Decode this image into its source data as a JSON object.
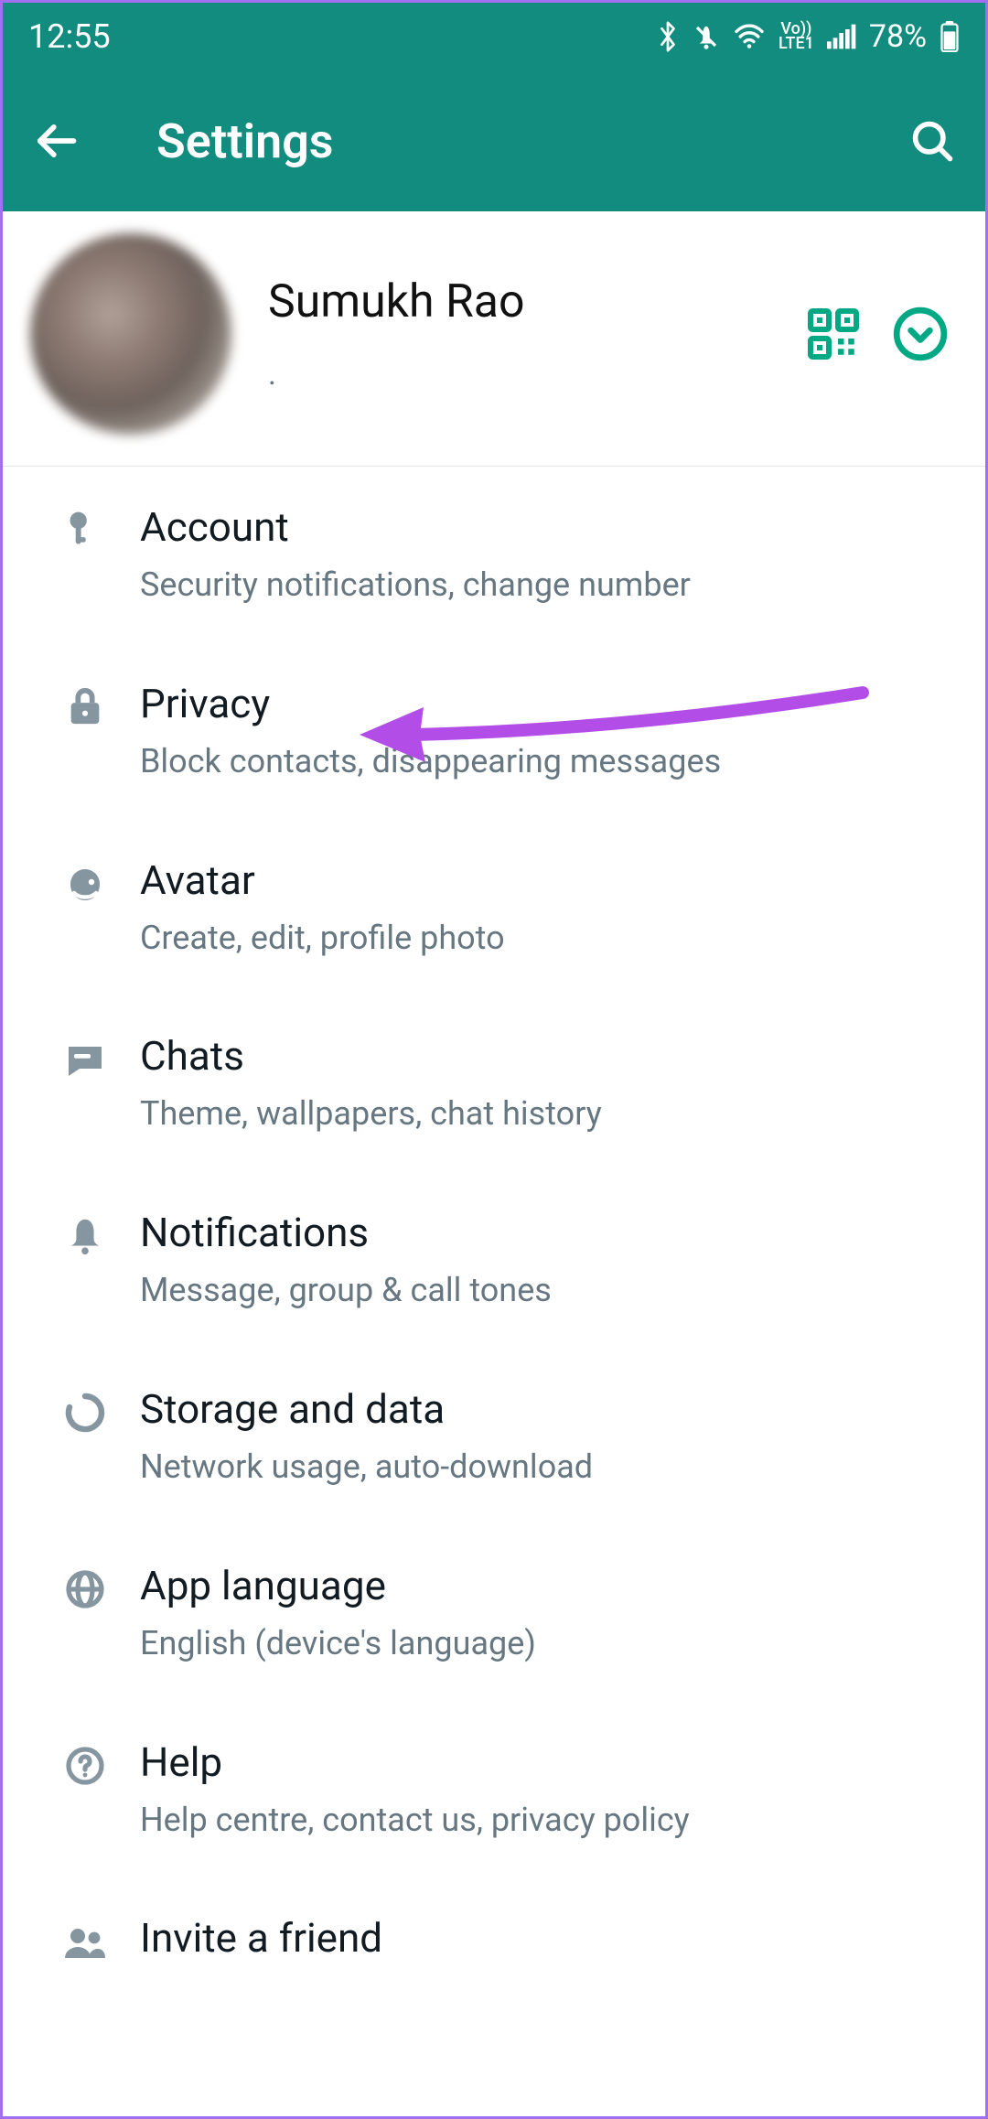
{
  "statusbar": {
    "time": "12:55",
    "lte_label": "Vo))\nLTE1",
    "battery_text": "78%"
  },
  "appbar": {
    "title": "Settings"
  },
  "profile": {
    "name": "Sumukh Rao",
    "status": "."
  },
  "items": [
    {
      "title": "Account",
      "sub": "Security notifications, change number"
    },
    {
      "title": "Privacy",
      "sub": "Block contacts, disappearing messages"
    },
    {
      "title": "Avatar",
      "sub": "Create, edit, profile photo"
    },
    {
      "title": "Chats",
      "sub": "Theme, wallpapers, chat history"
    },
    {
      "title": "Notifications",
      "sub": "Message, group & call tones"
    },
    {
      "title": "Storage and data",
      "sub": "Network usage, auto-download"
    },
    {
      "title": "App language",
      "sub": "English (device's language)"
    },
    {
      "title": "Help",
      "sub": "Help centre, contact us, privacy policy"
    },
    {
      "title": "Invite a friend",
      "sub": ""
    }
  ]
}
